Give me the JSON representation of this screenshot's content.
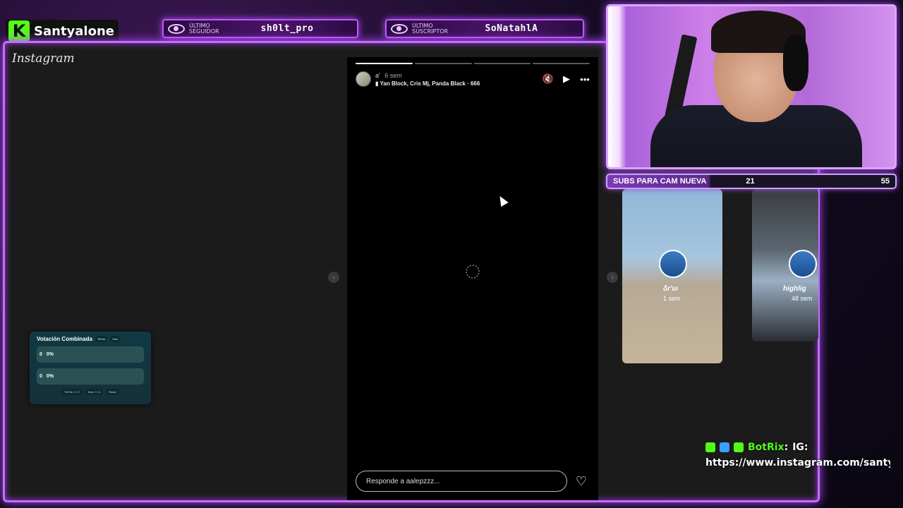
{
  "brand": {
    "name": "Santyalone",
    "logo_letter": "K",
    "logo_color": "#53fc18"
  },
  "alerts": [
    {
      "category_line1": "ÚLTIMO",
      "category_line2": "SEGUIDOR",
      "name": "sh0lt_pro"
    },
    {
      "category_line1": "ÚLTIMO",
      "category_line2": "SUSCRIPTOR",
      "name": "SoNatahlA"
    }
  ],
  "instagram": {
    "logo": "Instagram"
  },
  "story": {
    "progress_segments": 4,
    "progress_done": 1,
    "username": "a'",
    "time": "6 sem",
    "song": "Yan Block, Cris Mj, Panda Black · 666",
    "reply_placeholder": "Responde a aalepzzz...",
    "controls": [
      "mute-icon",
      "play-icon",
      "more-icon"
    ]
  },
  "side_stories": [
    {
      "name": "δr'υι",
      "time": "1 sem"
    },
    {
      "name": "highlig",
      "time": "48 sem"
    }
  ],
  "vote": {
    "title": "Votación Combinada",
    "tags": [
      "TikTok",
      "Kick"
    ],
    "option_a": {
      "count": "0",
      "percent": "0%"
    },
    "option_b": {
      "count": "0",
      "percent": "0%"
    },
    "footer": [
      "TikTok: 0 / 0",
      "Kick: 0 / 0",
      "Reset"
    ]
  },
  "goal": {
    "label": "SUBS PARA CAM NUEVA",
    "current": "21",
    "target": "55",
    "progress": 0.382
  },
  "chat": {
    "user": "BotRix",
    "message": "IG:",
    "url": "https://www.instagram.com/santyc"
  },
  "colors": {
    "accent": "#c46dff",
    "kick_green": "#53fc18"
  }
}
